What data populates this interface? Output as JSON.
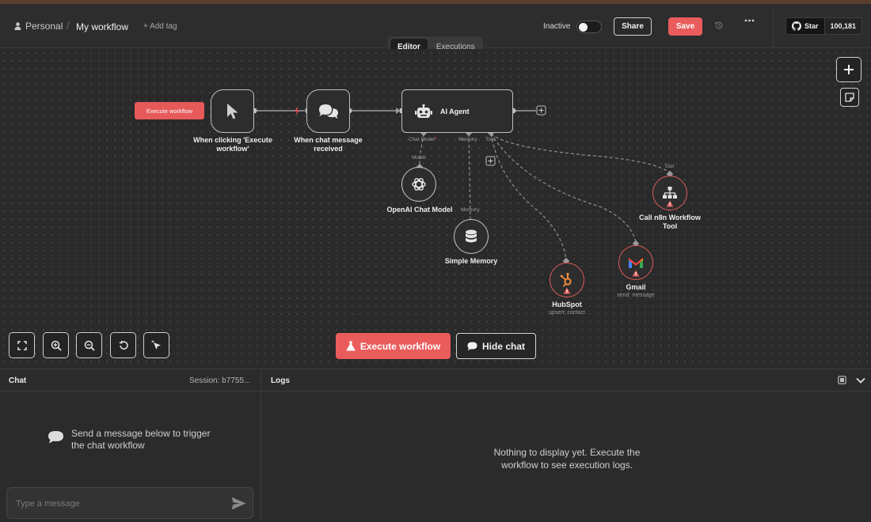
{
  "header": {
    "project": "Personal",
    "workflow_name": "My workflow",
    "add_tag": "+ Add tag",
    "status_label": "Inactive",
    "share_label": "Share",
    "save_label": "Save",
    "github_star_label": "Star",
    "github_star_count": "100,181"
  },
  "tabs": [
    {
      "label": "Editor",
      "active": true
    },
    {
      "label": "Executions",
      "active": false
    }
  ],
  "canvas": {
    "trigger_exec_label": "Execute workflow",
    "nodes": {
      "manual_trigger": "When clicking 'Execute workflow'",
      "chat_trigger": "When chat message received",
      "ai_agent": "AI Agent",
      "openai": "OpenAI Chat Model",
      "memory": "Simple Memory",
      "hubspot": "HubSpot",
      "hubspot_sub": "upsert: contact",
      "gmail": "Gmail",
      "gmail_sub": "send: message",
      "n8n_tool": "Call n8n Workflow Tool"
    },
    "ports": {
      "chat_model": "Chat Model",
      "required_mark": "*",
      "memory": "Memory",
      "tool": "Tool",
      "model": "Model",
      "memory_in": "Memory",
      "tool_in": "Tool"
    },
    "execute_button": "Execute workflow",
    "hide_chat_button": "Hide chat"
  },
  "chat": {
    "title": "Chat",
    "session": "Session: b7755...",
    "empty_message": "Send a message below to trigger the chat workflow",
    "input_placeholder": "Type a message"
  },
  "logs": {
    "title": "Logs",
    "empty_message": "Nothing to display yet. Execute the workflow to see execution logs."
  },
  "colors": {
    "accent": "#ea5c5c",
    "background": "#2a2a2a",
    "node_border": "#bfbfbf",
    "warning": "#e25a5a"
  }
}
